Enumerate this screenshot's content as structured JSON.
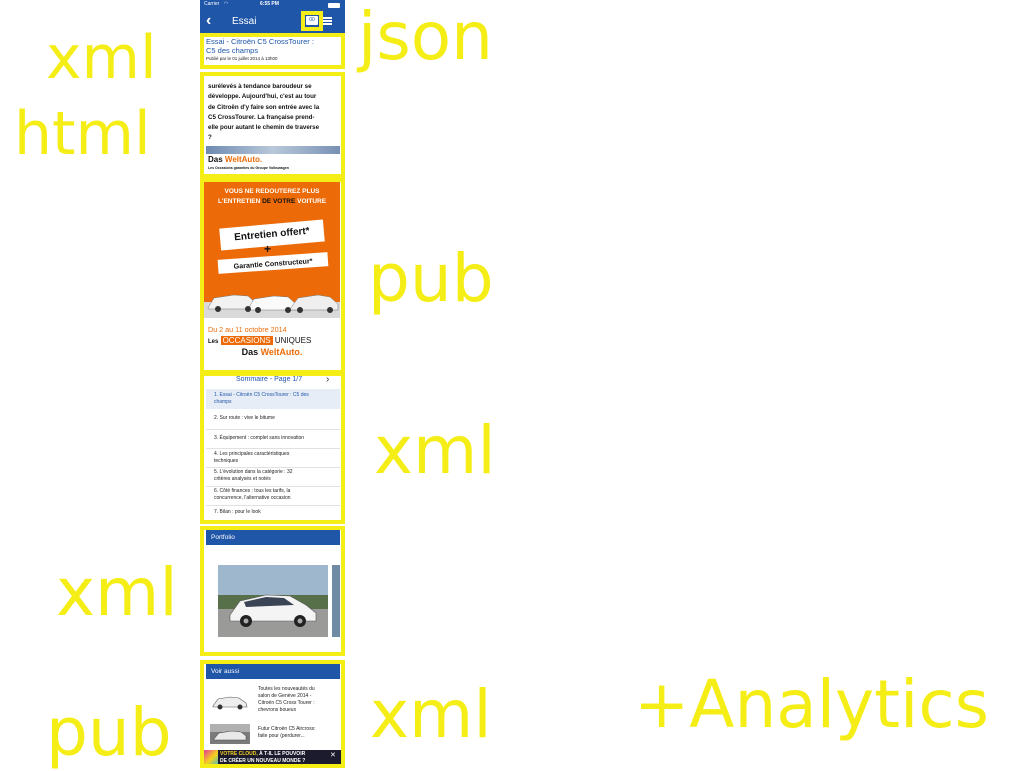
{
  "labels": {
    "xml_1": "xml",
    "html": "html",
    "json": "json",
    "pub_1": "pub",
    "xml_2": "xml",
    "xml_3": "xml",
    "pub_2": "pub",
    "xml_4": "xml",
    "analytics": "+Analytics"
  },
  "status_bar": {
    "carrier": "Carrier",
    "time": "6:55 PM"
  },
  "nav": {
    "title": "Essai",
    "badge": "00"
  },
  "article_header": {
    "title_line1": "Essai - Citroën C5 CrossTourer :",
    "title_line2": "C5 des champs",
    "published": "Publié par  le 01 juillet 2014 à 13h00"
  },
  "article_body": {
    "lines": [
      "surélevés à tendance baroudeur se",
      "développe. Aujourd'hui, c'est au tour",
      "de Citroën d'y faire son entrée avec la",
      "C5 CrossTourer. La française prend-",
      "elle pour autant le chemin de traverse",
      "?"
    ],
    "banner_brand_a": "Das ",
    "banner_brand_b": "WeltAuto.",
    "banner_sub": "Les Occasions garanties du Groupe Volkswagen"
  },
  "ad": {
    "line1": "VOUS NE REDOUTEREZ PLUS",
    "line2a": "L'ENTRETIEN ",
    "line2b": "DE VOTRE ",
    "line2c": "VOITURE",
    "offer1": "Entretien offert*",
    "plus": "+",
    "offer2": "Garantie Constructeur*",
    "dates": "Du 2 au 11 octobre 2014",
    "tag_les": "Les",
    "tag_occ": "OCCASIONS",
    "tag_uni": "UNIQUES",
    "brand_a": "Das ",
    "brand_b": "WeltAuto."
  },
  "summary": {
    "header": "Sommaire - Page 1/7",
    "items": [
      {
        "line1": "1. Essai - Citroën C5 CrossTourer : C5 des",
        "line2": "champs"
      },
      {
        "line1": "2. Sur route : vive le bitume",
        "line2": ""
      },
      {
        "line1": "3. Équipement : complet sans innovation",
        "line2": ""
      },
      {
        "line1": "4. Les principales caractéristiques",
        "line2": "techniques"
      },
      {
        "line1": "5. L'évolution dans la catégorie : 32",
        "line2": "critères analysés et notés"
      },
      {
        "line1": "6. Côté finances : tous les tarifs, la",
        "line2": "concurrence, l'alternative occasion"
      },
      {
        "line1": "7. Bilan : pour le look",
        "line2": ""
      }
    ]
  },
  "portfolio": {
    "header": "Portfolio"
  },
  "see_also": {
    "header": "Voir aussi",
    "items": [
      {
        "line1": "Toutes les nouveautés du",
        "line2": "salon de Genève 2014 -",
        "line3": "Citroën C5 Cross Tourer :",
        "line4": "chevrons boueux"
      },
      {
        "line1": "Futur Citroën C5 Aircross:",
        "line2": "faite pour (perdurer...",
        "line3": "",
        "line4": ""
      }
    ]
  },
  "bottom_ad": {
    "text1": "VOTRE CLOUD, ",
    "text2": "À T-IL LE POUVOIR",
    "text3": "DE CRÉER UN NOUVEAU MONDE ?"
  },
  "colors": {
    "annotation": "#f5ed16",
    "brand_blue": "#1f56a8",
    "ad_orange": "#ec6b08"
  }
}
